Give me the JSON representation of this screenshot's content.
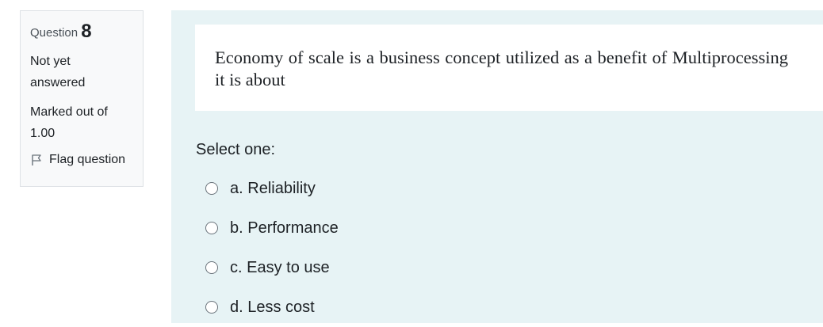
{
  "info": {
    "question_label": "Question",
    "question_number": "8",
    "state": "Not yet answered",
    "grade": "Marked out of 1.00",
    "flag_label": "Flag question"
  },
  "question": {
    "text": "Economy of scale is a business concept utilized as a benefit of Multiprocessing it is about",
    "prompt": "Select one:",
    "options": [
      {
        "letter": "a.",
        "label": "Reliability"
      },
      {
        "letter": "b.",
        "label": "Performance"
      },
      {
        "letter": "c.",
        "label": "Easy to use"
      },
      {
        "letter": "d.",
        "label": "Less cost"
      }
    ]
  },
  "icons": {
    "flag": "flag-outline-icon"
  },
  "colors": {
    "content_bg": "#e7f3f5",
    "info_bg": "#f8f9fa"
  }
}
